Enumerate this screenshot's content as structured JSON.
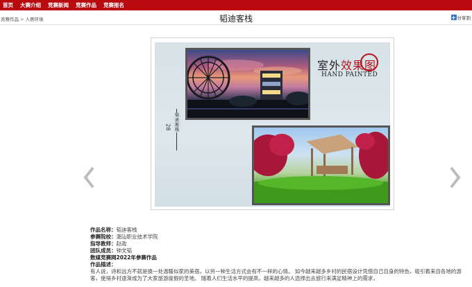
{
  "nav": {
    "items": [
      "首页",
      "大赛介绍",
      "竞赛新闻",
      "竞赛作品",
      "竞赛报名"
    ]
  },
  "breadcrumb": {
    "parent": "竞赛作品",
    "separator": ">",
    "current": "人居环境"
  },
  "page": {
    "title": "韬迪客栈"
  },
  "share": {
    "label": "分享到"
  },
  "gallery": {
    "spine_text": "韬迪客栈",
    "page_number": "28",
    "title_cn_black": "室外",
    "title_cn_red": "效果图",
    "title_en": "HAND PAINTED",
    "accent_color": "#b4141e"
  },
  "details": {
    "name_label": "作品名称：",
    "name_value": "韬迪客栈",
    "school_label": "参赛院校：",
    "school_value": "潮汕职业技术学院",
    "teacher_label": "指导教师：",
    "teacher_value": "赵政",
    "team_label": "团队成员：",
    "team_value": "钟文韬",
    "year_line": "数媒竞赛网2022年参赛作品",
    "desc_label": "作品描述：",
    "desc_text": "有人说，诗和远方不就是换一处温暖似家的美宿，以另一种生活方式会有不一样的心情。 如今越来越多乡村的民宿设计凭借自己自身的特色，吸引着来自各地的游客，使得乡村逐渐成为了大家旅游度假的圣地。 随着人们生活水平的提高，越来越多的人选择出去旅行来满足精神上的需求，"
  }
}
